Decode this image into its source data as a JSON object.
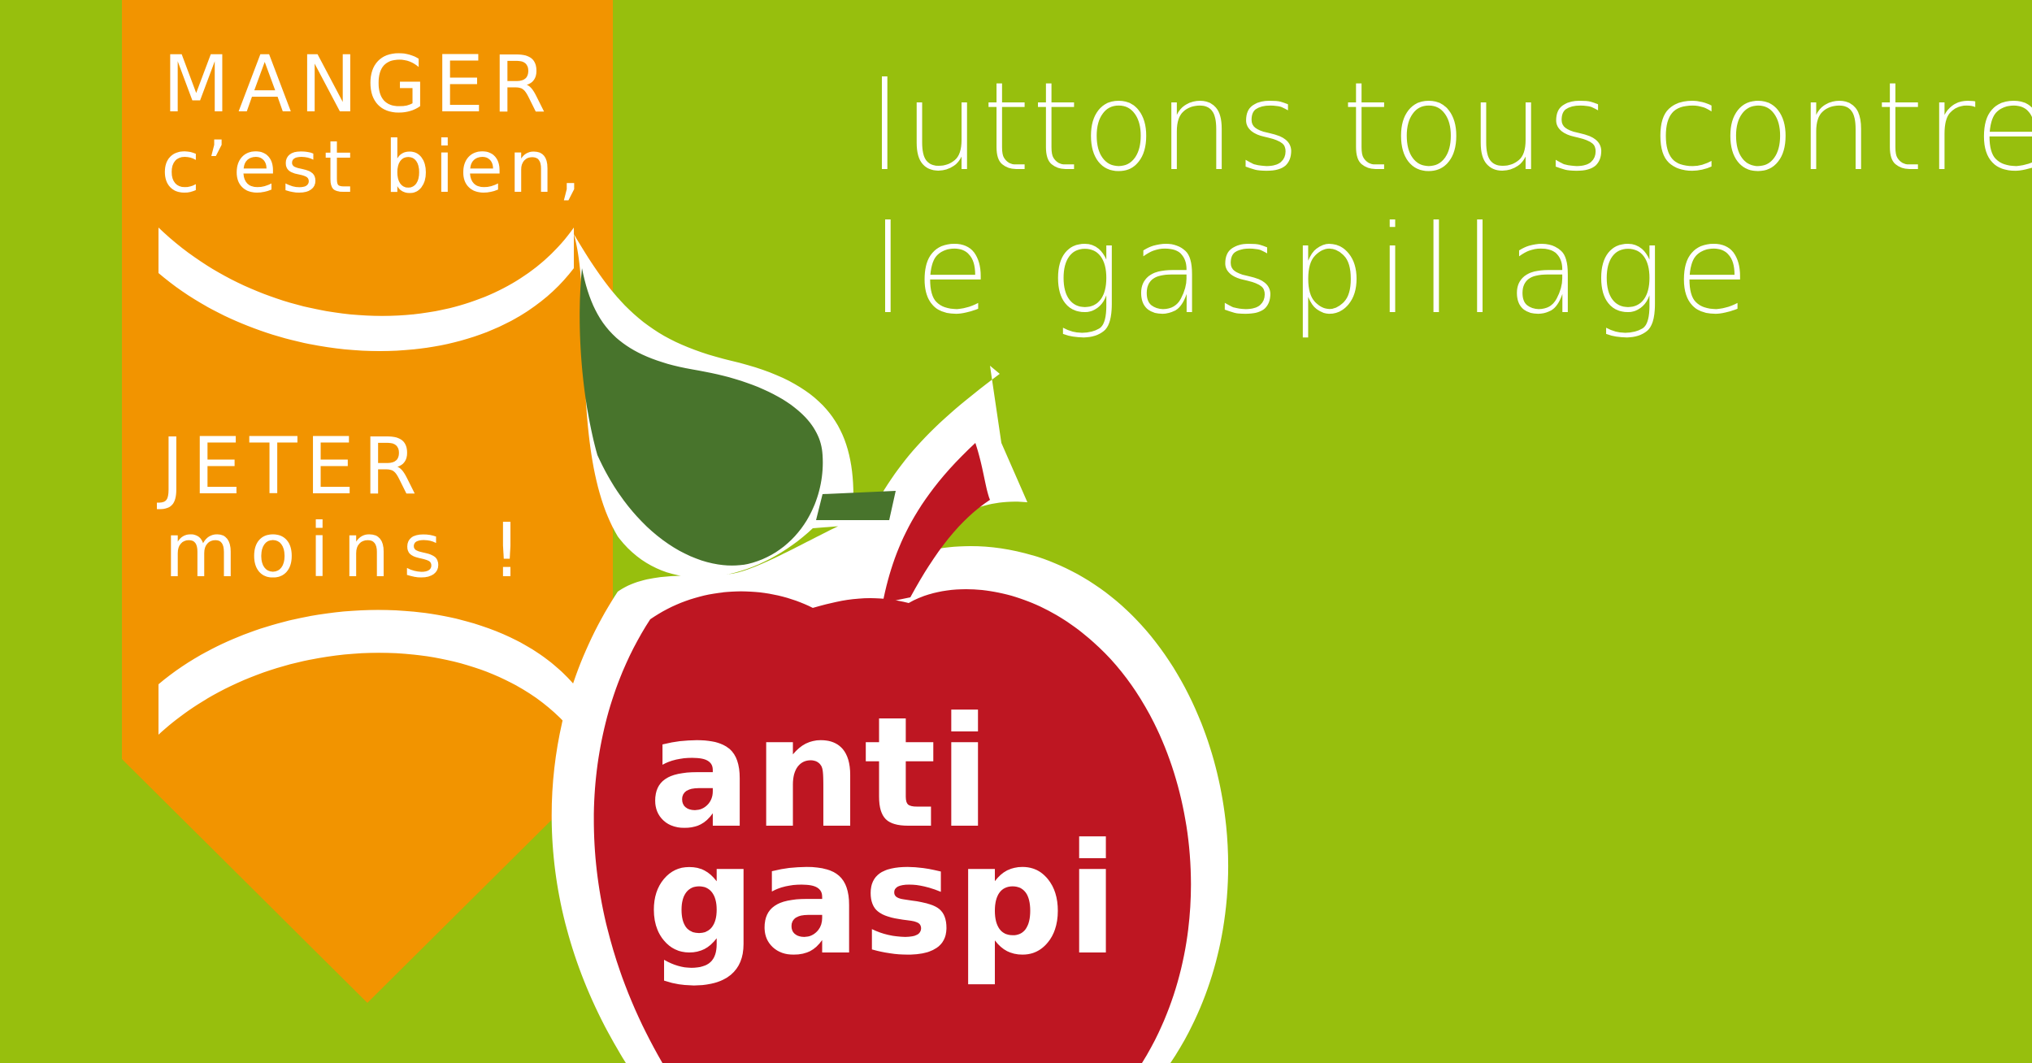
{
  "banner": {
    "line1": "MANGER",
    "line2": "c’est bien,",
    "line3": "JETER",
    "line4": "moins !"
  },
  "headline": {
    "line1": "luttons tous contre",
    "line2": "le gaspillage"
  },
  "apple": {
    "line1": "anti",
    "line2": "gaspi"
  },
  "colors": {
    "background": "#97bf0d",
    "banner": "#f29400",
    "apple": "#be1622",
    "leaf": "#48742c",
    "text": "#ffffff"
  },
  "icons": [
    "apple-icon",
    "leaf-icon",
    "smile-arc-icon"
  ]
}
